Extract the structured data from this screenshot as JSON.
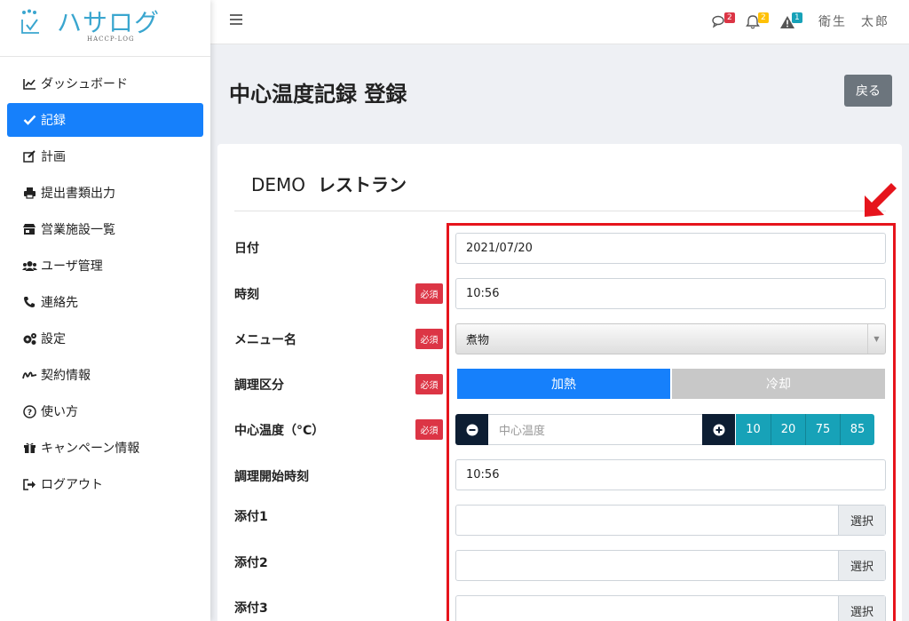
{
  "app": {
    "name": "ハサログ",
    "subtitle": "HACCP-LOG"
  },
  "sidebar": {
    "items": [
      {
        "label": "ダッシュボード",
        "icon": "chart-line-icon"
      },
      {
        "label": "記録",
        "icon": "check-icon",
        "active": true
      },
      {
        "label": "計画",
        "icon": "edit-icon"
      },
      {
        "label": "提出書類出力",
        "icon": "print-icon"
      },
      {
        "label": "営業施設一覧",
        "icon": "store-icon"
      },
      {
        "label": "ユーザ管理",
        "icon": "users-icon"
      },
      {
        "label": "連絡先",
        "icon": "phone-icon"
      },
      {
        "label": "設定",
        "icon": "cogs-icon"
      },
      {
        "label": "契約情報",
        "icon": "signature-icon"
      },
      {
        "label": "使い方",
        "icon": "question-circle-icon"
      },
      {
        "label": "キャンペーン情報",
        "icon": "gift-icon"
      },
      {
        "label": "ログアウト",
        "icon": "sign-out-icon"
      }
    ]
  },
  "topbar": {
    "messages_count": "2",
    "notifications_count": "2",
    "alerts_count": "1",
    "user_name": "衛生　太郎",
    "colors": {
      "messages": "#dc3545",
      "notifications": "#ffc107",
      "alerts": "#17a2b8"
    }
  },
  "page": {
    "title": "中心温度記録 登録",
    "back_label": "戻る",
    "restaurant_prefix": "DEMO",
    "restaurant_name": "レストラン"
  },
  "form": {
    "required_label": "必須",
    "date": {
      "label": "日付",
      "value": "2021/07/20"
    },
    "time": {
      "label": "時刻",
      "value": "10:56"
    },
    "menu": {
      "label": "メニュー名",
      "value": "煮物"
    },
    "cook_type": {
      "label": "調理区分",
      "options": [
        "加熱",
        "冷却"
      ],
      "selected": "加熱"
    },
    "center_temp": {
      "label": "中心温度（°C）",
      "placeholder": "中心温度",
      "presets": [
        "10",
        "20",
        "75",
        "85"
      ]
    },
    "start_time": {
      "label": "調理開始時刻",
      "value": "10:56"
    },
    "attachments": [
      {
        "label": "添付1",
        "button": "選択"
      },
      {
        "label": "添付2",
        "button": "選択"
      },
      {
        "label": "添付3",
        "button": "選択"
      }
    ]
  },
  "colors": {
    "primary": "#1680fb",
    "danger": "#dc3545",
    "info": "#17a2b8",
    "dark": "#0d1e33",
    "highlight": "#e6141c"
  }
}
